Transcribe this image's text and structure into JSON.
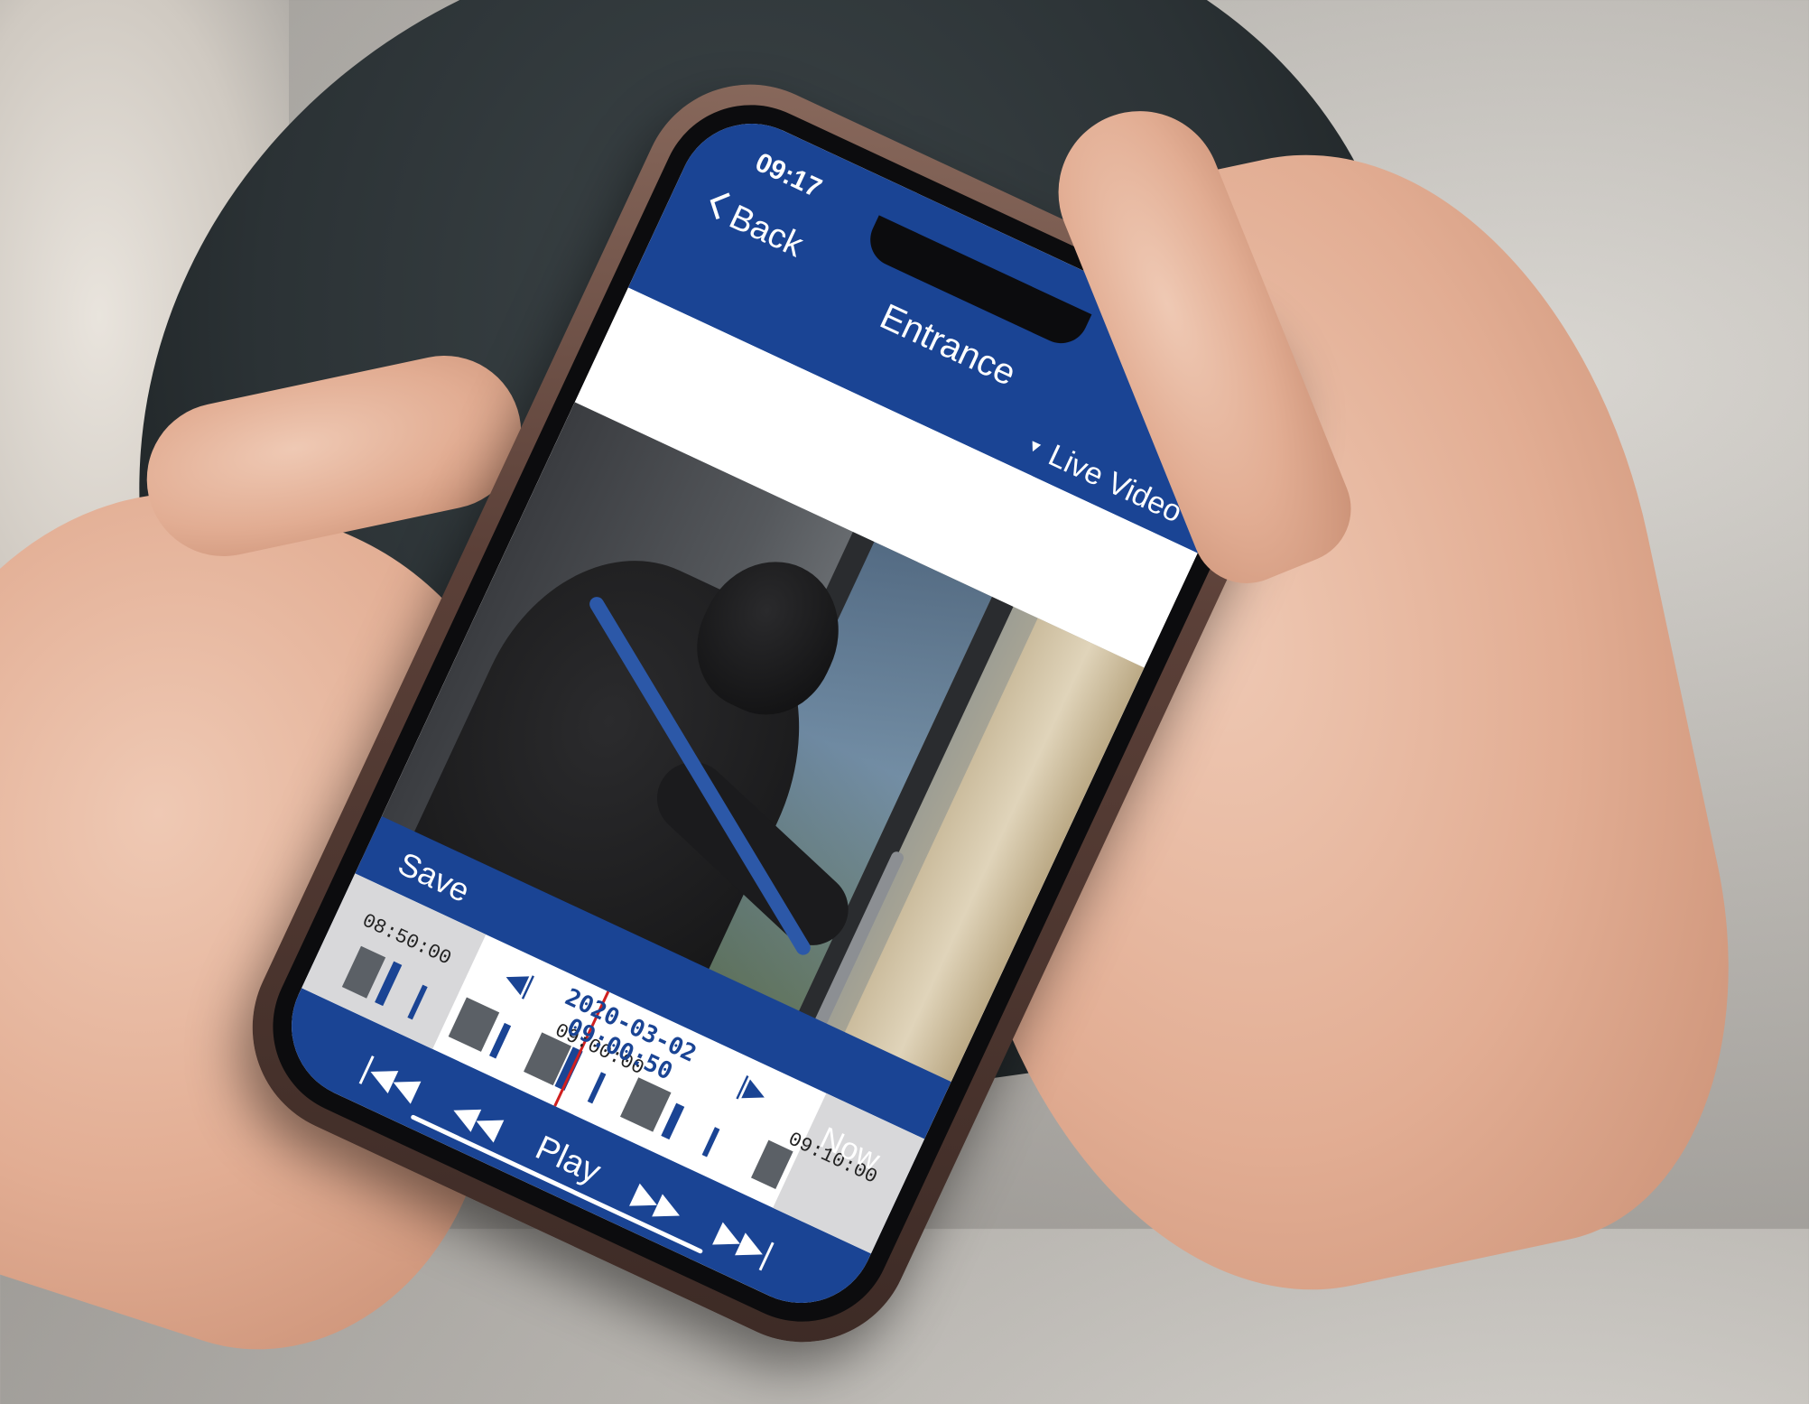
{
  "status_bar": {
    "time": "09:17"
  },
  "appbar": {
    "back_label": "Back",
    "title": "Entrance",
    "mode_label": "Live Video"
  },
  "player": {
    "save_label": "Save",
    "date": "2020-03-02",
    "time": "09:00:50",
    "now_label": "Now",
    "play_label": "Play",
    "timeline_ticks": [
      "08:50:00",
      "09:00:00",
      "09:10:00"
    ]
  },
  "colors": {
    "brand_blue": "#1a4494",
    "cursor_red": "#d02020"
  },
  "icons": [
    "back-chevron-icon",
    "signal-icon",
    "wifi-icon",
    "battery-icon",
    "dropdown-triangle-icon",
    "step-back-icon",
    "step-forward-icon",
    "skip-to-start-icon",
    "rewind-icon",
    "fast-forward-icon",
    "skip-to-end-icon"
  ]
}
